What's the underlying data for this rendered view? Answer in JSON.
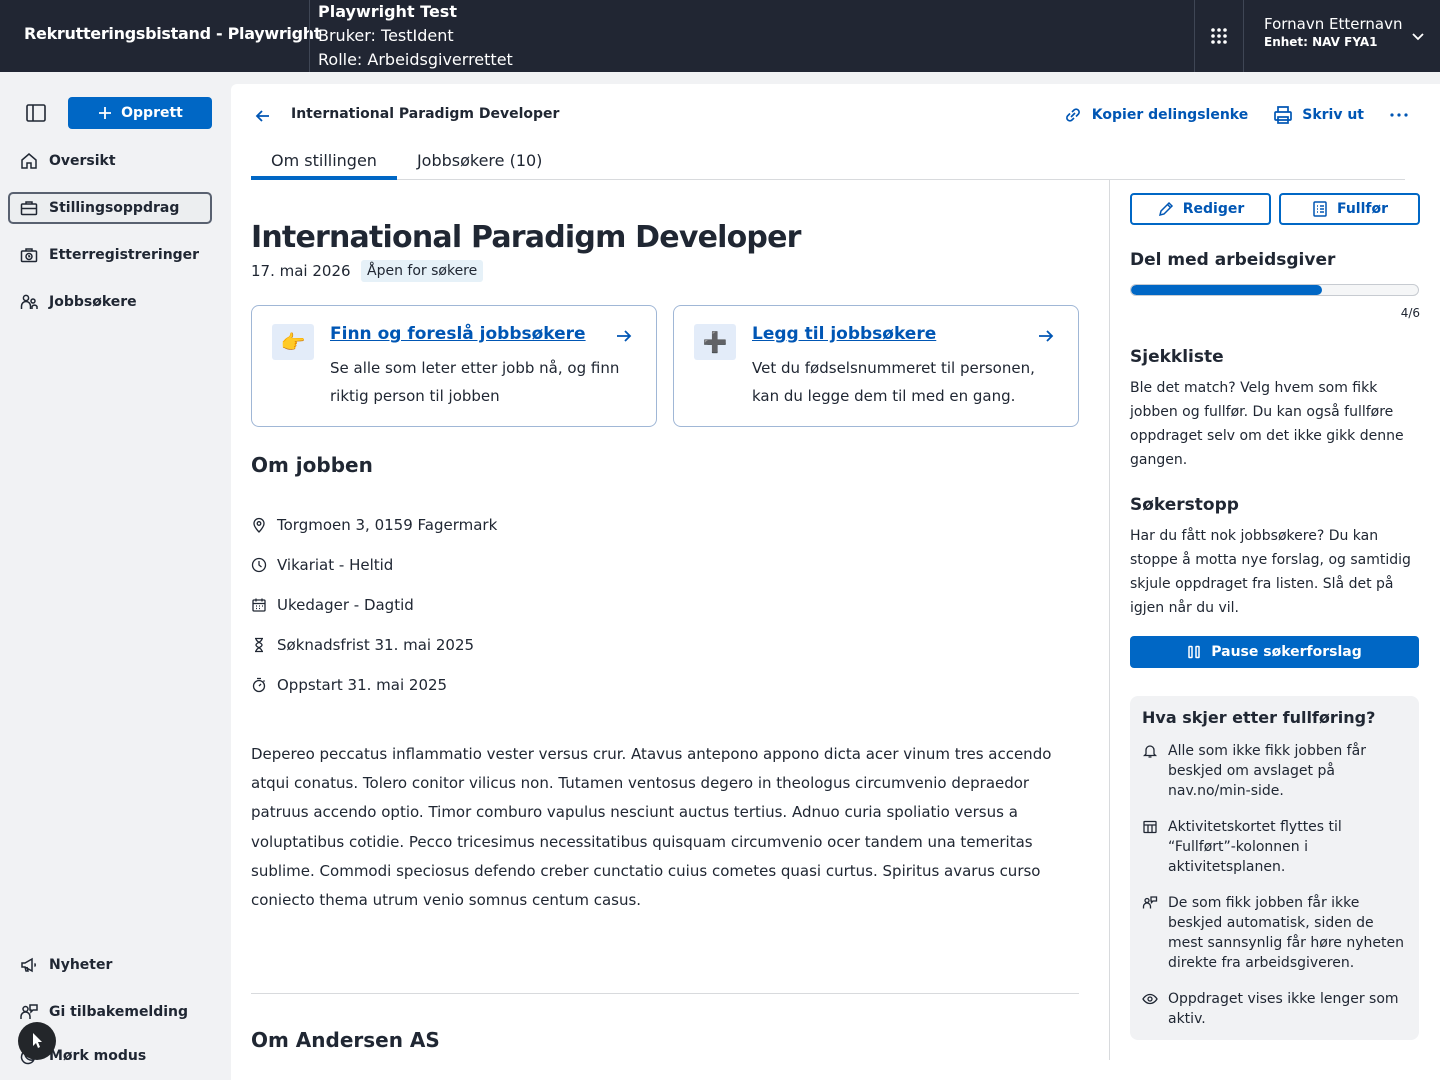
{
  "header": {
    "app_title": "Rekrutteringsbistand - Playwright",
    "test_title": "Playwright Test",
    "test_user": "Bruker: TestIdent",
    "test_role": "Rolle: Arbeidsgiverrettet",
    "user_name": "Fornavn Etternavn",
    "user_unit": "Enhet: NAV FYA1"
  },
  "sidebar": {
    "create_label": "Opprett",
    "items": [
      {
        "label": "Oversikt",
        "icon": "house-icon"
      },
      {
        "label": "Stillingsoppdrag",
        "icon": "briefcase-icon",
        "active": true
      },
      {
        "label": "Etterregistreringer",
        "icon": "briefcase-clock-icon"
      },
      {
        "label": "Jobbsøkere",
        "icon": "people-icon"
      }
    ],
    "bottom_items": [
      {
        "label": "Nyheter",
        "icon": "megaphone-icon"
      },
      {
        "label": "Gi tilbakemelding",
        "icon": "person-chat-icon"
      },
      {
        "label": "Mørk modus",
        "icon": "moon-icon"
      }
    ]
  },
  "page": {
    "breadcrumb": "International Paradigm Developer",
    "copy_link": "Kopier delingslenke",
    "print": "Skriv ut",
    "tabs": [
      "Om stillingen",
      "Jobbsøkere (10)"
    ],
    "title": "International Paradigm Developer",
    "date": "17. mai 2026",
    "status_badge": "Åpen for søkere",
    "cta_find": {
      "emoji": "👉",
      "title": "Finn og foreslå jobbsøkere",
      "text": "Se alle som leter etter jobb nå, og finn riktig person til jobben"
    },
    "cta_add": {
      "emoji": "➕",
      "title": "Legg til jobbsøkere",
      "text": "Vet du fødselsnummeret til personen, kan du legge dem til med en gang."
    },
    "about_heading": "Om jobben",
    "facts": [
      {
        "icon": "location-pin-icon",
        "text": "Torgmoen 3, 0159 Fagermark"
      },
      {
        "icon": "clock-icon",
        "text": "Vikariat - Heltid"
      },
      {
        "icon": "calendar-icon",
        "text": "Ukedager - Dagtid"
      },
      {
        "icon": "hourglass-icon",
        "text": "Søknadsfrist 31. mai 2025"
      },
      {
        "icon": "stopwatch-icon",
        "text": "Oppstart 31. mai 2025"
      }
    ],
    "description": "Depereo peccatus inflammatio vester versus crur. Atavus antepono appono dicta acer vinum tres accendo atqui conatus. Tolero conitor vilicus non. Tutamen ventosus degero in theologus circumvenio depraedor patruus accendo optio. Timor comburo vapulus nesciunt auctus tertius. Adnuo curia spoliatio versus a voluptatibus cotidie. Pecco tricesimus necessitatibus quisquam circumvenio ocer tandem una temeritas sublime. Commodi speciosus defendo creber cunctatio cuius cometes quasi curtus. Spiritus avarus curso coniecto thema utrum venio somnus centum casus.",
    "employer_heading": "Om Andersen AS"
  },
  "panel": {
    "edit_label": "Rediger",
    "finish_label": "Fullfør",
    "share_heading": "Del med arbeidsgiver",
    "progress_value": 4,
    "progress_max": 6,
    "progress_label": "4/6",
    "checklist_heading": "Sjekkliste",
    "checklist_text": "Ble det match? Velg hvem som fikk jobben og fullfør. Du kan også fullføre oppdraget selv om det ikke gikk denne gangen.",
    "stop_heading": "Søkerstopp",
    "stop_text": "Har du fått nok jobbsøkere? Du kan stoppe å motta nye forslag, og samtidig skjule oppdraget fra listen. Slå det på igjen når du vil.",
    "pause_label": "Pause søkerforslag",
    "info_title": "Hva skjer etter fullføring?",
    "info_items": [
      {
        "icon": "bell-icon",
        "text": "Alle som ikke fikk jobben får beskjed om avslaget på nav.no/min-side."
      },
      {
        "icon": "table-icon",
        "text": "Aktivitetskortet flyttes til “Fullført”-kolonnen i aktivitetsplanen."
      },
      {
        "icon": "person-chat-icon",
        "text": "De som fikk jobben får ikke beskjed automatisk, siden de mest sannsynlig får høre nyheten direkte fra arbeidsgiveren."
      },
      {
        "icon": "eye-icon",
        "text": "Oppdraget vises ikke lenger som aktiv."
      }
    ]
  },
  "colors": {
    "header_bg": "#212633",
    "accent": "#0067c5",
    "link": "#0056b4",
    "badge_bg": "#e6f1f8"
  }
}
